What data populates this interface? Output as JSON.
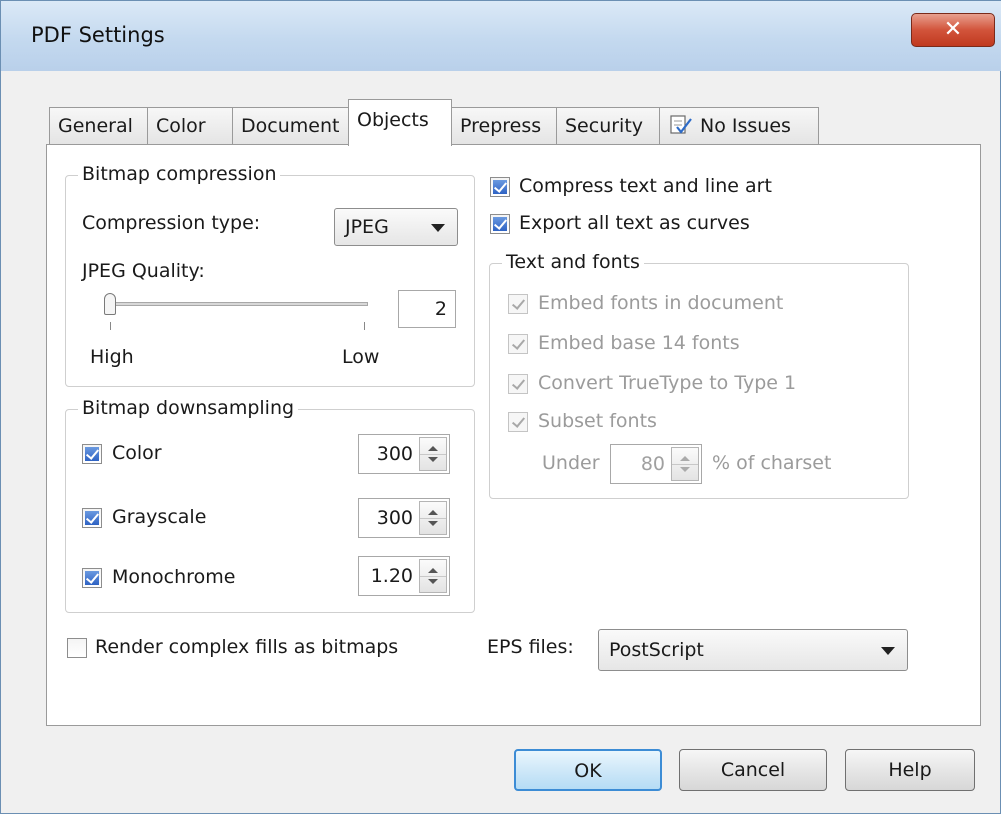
{
  "window": {
    "title": "PDF Settings",
    "close_glyph": "✕"
  },
  "tabs": [
    {
      "label": "General"
    },
    {
      "label": "Color"
    },
    {
      "label": "Document"
    },
    {
      "label": "Objects",
      "active": true
    },
    {
      "label": "Prepress"
    },
    {
      "label": "Security"
    },
    {
      "label": "No Issues",
      "icon": "checklist-icon"
    }
  ],
  "bitmap_compression": {
    "title": "Bitmap compression",
    "type_label": "Compression type:",
    "type_value": "JPEG",
    "quality_label": "JPEG Quality:",
    "quality_value": "2",
    "high_label": "High",
    "low_label": "Low"
  },
  "bitmap_downsampling": {
    "title": "Bitmap downsampling",
    "items": [
      {
        "label": "Color",
        "checked": true,
        "value": "300"
      },
      {
        "label": "Grayscale",
        "checked": true,
        "value": "300"
      },
      {
        "label": "Monochrome",
        "checked": true,
        "value": "1.20"
      }
    ]
  },
  "options": {
    "compress_text": {
      "label": "Compress text and line art",
      "checked": true
    },
    "export_curves": {
      "label": "Export all text as curves",
      "checked": true
    },
    "render_fills": {
      "label": "Render complex fills as bitmaps",
      "checked": false
    }
  },
  "text_and_fonts": {
    "title": "Text and fonts",
    "embed_fonts": "Embed fonts in document",
    "embed_base14": "Embed base 14 fonts",
    "convert_truetype": "Convert TrueType to Type 1",
    "subset_fonts": "Subset fonts",
    "under_label": "Under",
    "under_value": "80",
    "charset_label": "% of charset"
  },
  "eps": {
    "label": "EPS files:",
    "value": "PostScript"
  },
  "buttons": {
    "ok": "OK",
    "cancel": "Cancel",
    "help": "Help"
  },
  "colors": {
    "accent": "#3c8cd5",
    "check": "#2f63c4",
    "disabled_text": "#9b9b9b"
  }
}
